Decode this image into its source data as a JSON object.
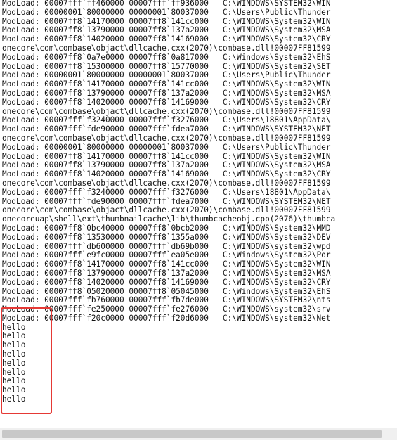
{
  "console": {
    "lines": [
      "ModLoad: 00007fff`ff460000 00007fff`ff936000   C:\\WINDOWS\\SYSTEM32\\WIN",
      "ModLoad: 00000001`80000000 00000001`80037000   C:\\Users\\Public\\Thunder",
      "ModLoad: 00007ff8`14170000 00007ff8`141cc000   C:\\WINDOWS\\System32\\WIN",
      "ModLoad: 00007ff8`13790000 00007ff8`137a2000   C:\\WINDOWS\\System32\\MSA",
      "ModLoad: 00007ff8`14020000 00007ff8`14169000   C:\\WINDOWS\\System32\\CRY",
      "onecore\\com\\combase\\objact\\dllcache.cxx(2070)\\combase.dll!00007FF81599",
      "ModLoad: 00007ff8`0a7e0000 00007ff8`0a817000   C:\\Windows\\System32\\EhS",
      "ModLoad: 00007ff8`15300000 00007ff8`15770000   C:\\WINDOWS\\System32\\SET",
      "ModLoad: 00000001`80000000 00000001`80037000   C:\\Users\\Public\\Thunder",
      "ModLoad: 00007ff8`14170000 00007ff8`141cc000   C:\\WINDOWS\\System32\\WIN",
      "ModLoad: 00007ff8`13790000 00007ff8`137a2000   C:\\WINDOWS\\System32\\MSA",
      "ModLoad: 00007ff8`14020000 00007ff8`14169000   C:\\WINDOWS\\System32\\CRY",
      "onecore\\com\\combase\\objact\\dllcache.cxx(2070)\\combase.dll!00007FF81599",
      "ModLoad: 00007fff`f3240000 00007fff`f3276000   C:\\Users\\18801\\AppData\\",
      "ModLoad: 00007fff`fde90000 00007fff`fdea7000   C:\\WINDOWS\\SYSTEM32\\NET",
      "onecore\\com\\combase\\objact\\dllcache.cxx(2070)\\combase.dll!00007FF81599",
      "ModLoad: 00000001`80000000 00000001`80037000   C:\\Users\\Public\\Thunder",
      "ModLoad: 00007ff8`14170000 00007ff8`141cc000   C:\\WINDOWS\\System32\\WIN",
      "ModLoad: 00007ff8`13790000 00007ff8`137a2000   C:\\WINDOWS\\System32\\MSA",
      "ModLoad: 00007ff8`14020000 00007ff8`14169000   C:\\WINDOWS\\System32\\CRY",
      "onecore\\com\\combase\\objact\\dllcache.cxx(2070)\\combase.dll!00007FF81599",
      "ModLoad: 00007fff`f3240000 00007fff`f3276000   C:\\Users\\18801\\AppData\\",
      "ModLoad: 00007fff`fde90000 00007fff`fdea7000   C:\\WINDOWS\\SYSTEM32\\NET",
      "onecore\\com\\combase\\objact\\dllcache.cxx(2070)\\combase.dll!00007FF81599",
      "onecoreuap\\shell\\ext\\thumbnailcache\\lib\\thumbcacheobj.cpp(2076)\\thumbca",
      "ModLoad: 00007ff8`0bc40000 00007ff8`0bcb2000   C:\\WINDOWS\\System32\\MMD",
      "ModLoad: 00007ff8`13530000 00007ff8`1355a000   C:\\WINDOWS\\System32\\DEV",
      "ModLoad: 00007fff`db600000 00007fff`db69b000   C:\\WINDOWS\\system32\\wpd",
      "ModLoad: 00007fff`e9fc0000 00007fff`ea05e000   C:\\Windows\\System32\\Por",
      "ModLoad: 00007ff8`14170000 00007ff8`141cc000   C:\\WINDOWS\\System32\\WIN",
      "ModLoad: 00007ff8`13790000 00007ff8`137a2000   C:\\WINDOWS\\System32\\MSA",
      "ModLoad: 00007ff8`14020000 00007ff8`14169000   C:\\WINDOWS\\System32\\CRY",
      "ModLoad: 00007ff8`05020000 00007ff8`05045000   C:\\Windows\\System32\\EhS",
      "ModLoad: 00007fff`fb760000 00007fff`fb7de000   C:\\WINDOWS\\SYSTEM32\\nts",
      "ModLoad: 00007fff`fe250000 00007fff`fe276000   C:\\WINDOWS\\system32\\srv",
      "ModLoad: 00007fff`f20c0000 00007fff`f20d6000   C:\\WINDOWS\\system32\\Net",
      "hello",
      "hello",
      "hello",
      "hello",
      "hello",
      "hello",
      "hello",
      "hello",
      "hello"
    ]
  },
  "highlight": {
    "color": "#e53935",
    "covers_output": "hello"
  }
}
